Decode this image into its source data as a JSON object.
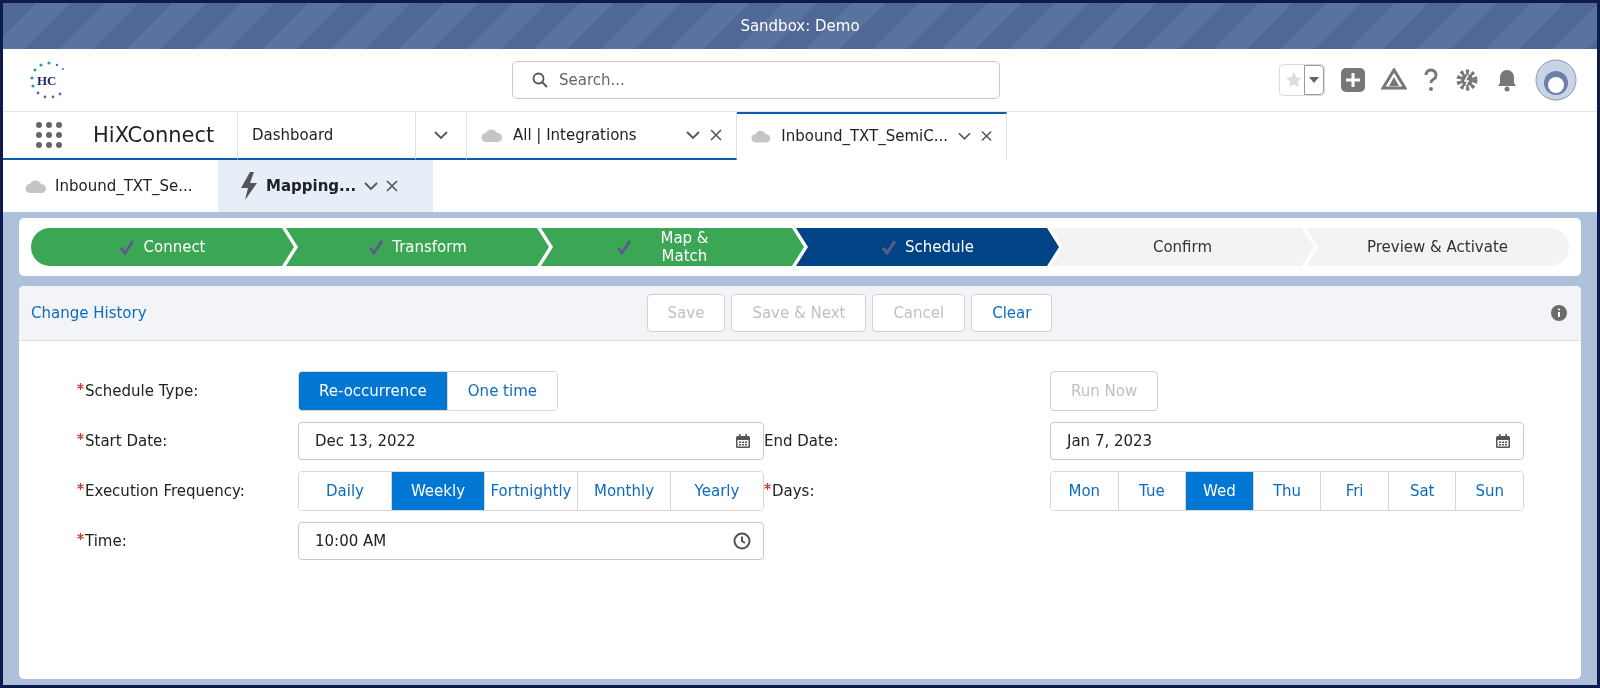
{
  "banner": {
    "title": "Sandbox: Demo"
  },
  "header": {
    "search": {
      "placeholder": "Search..."
    }
  },
  "logo_text": "HC",
  "app_name": "HiXConnect",
  "nav_tabs": [
    {
      "label": "Dashboard",
      "kind": "plain",
      "selected": false
    },
    {
      "label": "All | Integrations",
      "kind": "cloud",
      "selected": false
    },
    {
      "label": "Inbound_TXT_SemiC...",
      "kind": "cloud",
      "selected": true
    }
  ],
  "sub_tabs": [
    {
      "label": "Inbound_TXT_Se...",
      "kind": "cloud",
      "selected": false
    },
    {
      "label": "Mapping...",
      "kind": "lightning",
      "selected": true
    }
  ],
  "path": [
    {
      "label": "Connect",
      "completed": true,
      "selected": false
    },
    {
      "label": "Transform",
      "completed": true,
      "selected": false
    },
    {
      "label": "Map & Match",
      "completed": true,
      "selected": false
    },
    {
      "label": "Schedule",
      "completed": true,
      "selected": true
    },
    {
      "label": "Confirm",
      "completed": false,
      "selected": false
    },
    {
      "label": "Preview & Activate",
      "completed": false,
      "selected": false
    }
  ],
  "toolbar": {
    "link": "Change History",
    "buttons": [
      {
        "label": "Save",
        "disabled": true
      },
      {
        "label": "Save & Next",
        "disabled": true
      },
      {
        "label": "Cancel",
        "disabled": true
      },
      {
        "label": "Clear",
        "disabled": false
      }
    ]
  },
  "form": {
    "schedule_type": {
      "label": "Schedule Type:",
      "required": true,
      "options": [
        {
          "label": "Re-occurrence",
          "selected": true
        },
        {
          "label": "One time",
          "selected": false
        }
      ]
    },
    "run_now": {
      "label": "Run Now",
      "disabled": true
    },
    "start_date": {
      "label": "Start Date:",
      "required": true,
      "value": "Dec 13, 2022"
    },
    "end_date": {
      "label": "End Date:",
      "required": false,
      "value": "Jan 7, 2023"
    },
    "frequency": {
      "label": "Execution Frequency:",
      "required": true,
      "options": [
        {
          "label": "Daily",
          "selected": false
        },
        {
          "label": "Weekly",
          "selected": true
        },
        {
          "label": "Fortnightly",
          "selected": false
        },
        {
          "label": "Monthly",
          "selected": false
        },
        {
          "label": "Yearly",
          "selected": false
        }
      ]
    },
    "days": {
      "label": "Days:",
      "required": true,
      "options": [
        {
          "label": "Mon",
          "selected": false
        },
        {
          "label": "Tue",
          "selected": false
        },
        {
          "label": "Wed",
          "selected": true
        },
        {
          "label": "Thu",
          "selected": false
        },
        {
          "label": "Fri",
          "selected": false
        },
        {
          "label": "Sat",
          "selected": false
        },
        {
          "label": "Sun",
          "selected": false
        }
      ]
    },
    "time": {
      "label": "Time:",
      "required": true,
      "value": "10:00 AM"
    }
  }
}
